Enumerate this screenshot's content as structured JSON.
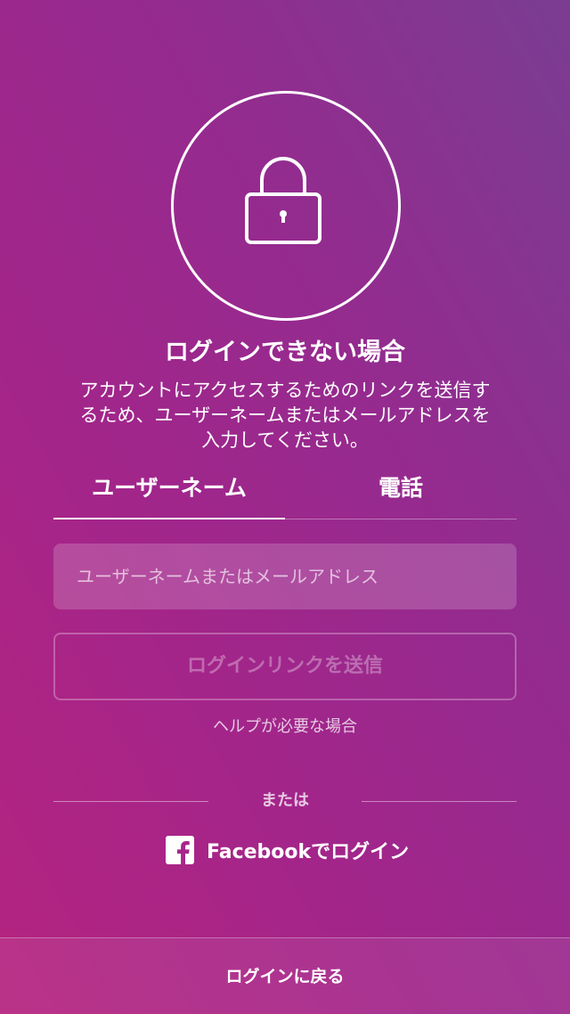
{
  "header": {
    "lock_icon": "lock-icon",
    "title": "ログインできない場合",
    "description": "アカウントにアクセスするためのリンクを送信するため、ユーザーネームまたはメールアドレスを入力してください。"
  },
  "tabs": [
    {
      "label": "ユーザーネーム",
      "active": true
    },
    {
      "label": "電話",
      "active": false
    }
  ],
  "form": {
    "input_value": "",
    "input_placeholder": "ユーザーネームまたはメールアドレス",
    "send_label": "ログインリンクを送信",
    "send_enabled": false,
    "help_label": "ヘルプが必要な場合"
  },
  "alternative": {
    "or_label": "または",
    "facebook_icon": "facebook-icon",
    "facebook_label": "Facebookでログイン"
  },
  "footer": {
    "back_label": "ログインに戻る"
  },
  "colors": {
    "gradient_start": "#b5247f",
    "gradient_end": "#7a3d92",
    "text": "#ffffff"
  }
}
